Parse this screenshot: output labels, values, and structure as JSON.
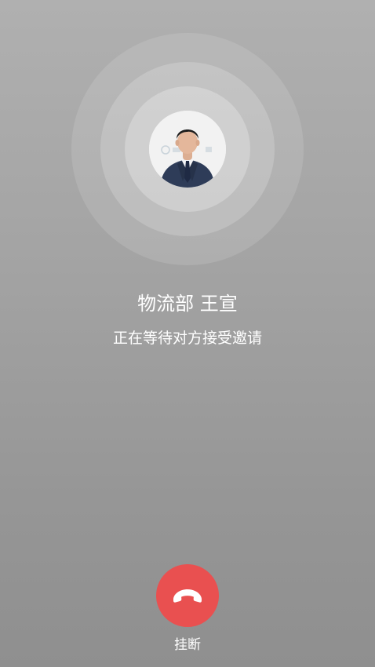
{
  "caller": {
    "name": "物流部 王宣",
    "status": "正在等待对方接受邀请"
  },
  "actions": {
    "hangup_label": "挂断",
    "hangup_icon": "phone-hangup-icon"
  },
  "colors": {
    "background_top": "#b0b0b0",
    "background_bottom": "#8f8f8f",
    "hangup": "#e95050",
    "text": "#ffffff"
  }
}
